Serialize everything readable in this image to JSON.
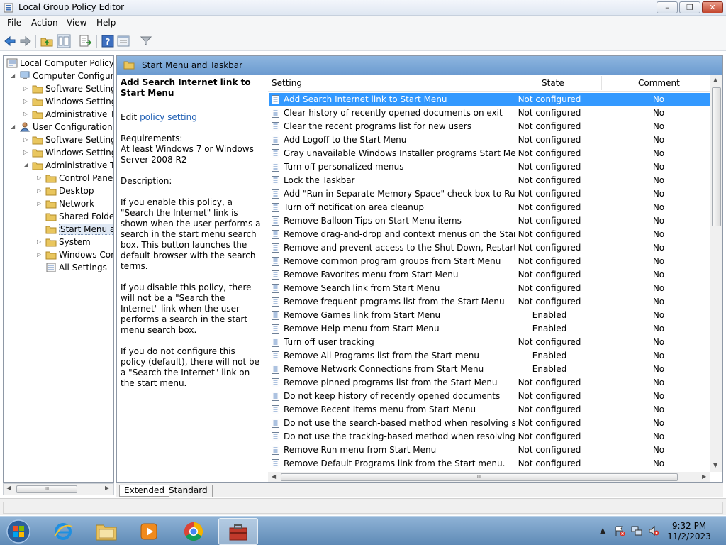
{
  "window": {
    "title": "Local Group Policy Editor",
    "controls": {
      "minimize": "–",
      "maximize": "❐",
      "close": "✕"
    }
  },
  "menu": [
    "File",
    "Action",
    "View",
    "Help"
  ],
  "toolbar": {
    "icons": [
      "back-icon",
      "forward-icon",
      "up-folder-icon",
      "show-hide-tree-icon",
      "export-list-icon",
      "help-icon",
      "properties-icon",
      "filter-icon"
    ]
  },
  "tree": {
    "nodes": [
      {
        "label": "Local Computer Policy"
      },
      {
        "label": "Computer Configura"
      },
      {
        "label": "Software Settings"
      },
      {
        "label": "Windows Setting:"
      },
      {
        "label": "Administrative Te"
      },
      {
        "label": "User Configuration"
      },
      {
        "label": "Software Settings"
      },
      {
        "label": "Windows Setting:"
      },
      {
        "label": "Administrative Te"
      },
      {
        "label": "Control Panel"
      },
      {
        "label": "Desktop"
      },
      {
        "label": "Network"
      },
      {
        "label": "Shared Folder"
      },
      {
        "label": "Start Menu ar"
      },
      {
        "label": "System"
      },
      {
        "label": "Windows Cor"
      },
      {
        "label": "All Settings"
      }
    ],
    "hscroll_label": "III"
  },
  "pane": {
    "header": "Start Menu and Taskbar"
  },
  "description": {
    "title": "Add Search Internet link to Start Menu",
    "edit_prefix": "Edit ",
    "edit_link": "policy setting",
    "requirements_label": "Requirements:",
    "requirements": "At least Windows 7 or Windows Server 2008 R2",
    "description_label": "Description:",
    "para1": "If you enable this policy, a \"Search the Internet\" link is shown when the user performs a search in the start menu search box.  This button launches the default browser with the search terms.",
    "para2": "If you disable this policy, there will not be a \"Search the Internet\" link when the user performs a search in the start menu search box.",
    "para3": "If you do not configure this policy (default), there will not be a \"Search the Internet\" link on the start menu."
  },
  "list": {
    "columns": {
      "setting": "Setting",
      "state": "State",
      "comment": "Comment"
    },
    "rows": [
      {
        "setting": "Add Search Internet link to Start Menu",
        "state": "Not configured",
        "comment": "No"
      },
      {
        "setting": "Clear history of recently opened documents on exit",
        "state": "Not configured",
        "comment": "No"
      },
      {
        "setting": "Clear the recent programs list for new users",
        "state": "Not configured",
        "comment": "No"
      },
      {
        "setting": "Add Logoff to the Start Menu",
        "state": "Not configured",
        "comment": "No"
      },
      {
        "setting": "Gray unavailable Windows Installer programs Start Menu sh...",
        "state": "Not configured",
        "comment": "No"
      },
      {
        "setting": "Turn off personalized menus",
        "state": "Not configured",
        "comment": "No"
      },
      {
        "setting": "Lock the Taskbar",
        "state": "Not configured",
        "comment": "No"
      },
      {
        "setting": "Add \"Run in Separate Memory Space\" check box to Run dial...",
        "state": "Not configured",
        "comment": "No"
      },
      {
        "setting": "Turn off notification area cleanup",
        "state": "Not configured",
        "comment": "No"
      },
      {
        "setting": "Remove Balloon Tips on Start Menu items",
        "state": "Not configured",
        "comment": "No"
      },
      {
        "setting": "Remove drag-and-drop and context menus on the Start Me...",
        "state": "Not configured",
        "comment": "No"
      },
      {
        "setting": "Remove and prevent access to the Shut Down, Restart, Sleep...",
        "state": "Not configured",
        "comment": "No"
      },
      {
        "setting": "Remove common program groups from Start Menu",
        "state": "Not configured",
        "comment": "No"
      },
      {
        "setting": "Remove Favorites menu from Start Menu",
        "state": "Not configured",
        "comment": "No"
      },
      {
        "setting": "Remove Search link from Start Menu",
        "state": "Not configured",
        "comment": "No"
      },
      {
        "setting": "Remove frequent programs list from the Start Menu",
        "state": "Not configured",
        "comment": "No"
      },
      {
        "setting": "Remove Games link from Start Menu",
        "state": "Enabled",
        "comment": "No"
      },
      {
        "setting": "Remove Help menu from Start Menu",
        "state": "Enabled",
        "comment": "No"
      },
      {
        "setting": "Turn off user tracking",
        "state": "Not configured",
        "comment": "No"
      },
      {
        "setting": "Remove All Programs list from the Start menu",
        "state": "Enabled",
        "comment": "No"
      },
      {
        "setting": "Remove Network Connections from Start Menu",
        "state": "Enabled",
        "comment": "No"
      },
      {
        "setting": "Remove pinned programs list from the Start Menu",
        "state": "Not configured",
        "comment": "No"
      },
      {
        "setting": "Do not keep history of recently opened documents",
        "state": "Not configured",
        "comment": "No"
      },
      {
        "setting": "Remove Recent Items menu from Start Menu",
        "state": "Not configured",
        "comment": "No"
      },
      {
        "setting": "Do not use the search-based method when resolving shell s...",
        "state": "Not configured",
        "comment": "No"
      },
      {
        "setting": "Do not use the tracking-based method when resolving shell ...",
        "state": "Not configured",
        "comment": "No"
      },
      {
        "setting": "Remove Run menu from Start Menu",
        "state": "Not configured",
        "comment": "No"
      },
      {
        "setting": "Remove Default Programs link from the Start menu.",
        "state": "Not configured",
        "comment": "No"
      }
    ],
    "hscroll_label": "III"
  },
  "tabs": [
    {
      "label": "Extended"
    },
    {
      "label": "Standard"
    }
  ],
  "taskbar": {
    "buttons": [
      "start-orb-icon",
      "internet-explorer-icon",
      "file-explorer-icon",
      "media-player-icon",
      "chrome-icon",
      "group-policy-editor-icon"
    ],
    "clock_time": "9:32 PM",
    "clock_date": "11/2/2023"
  },
  "colors": {
    "selection": "#3399ff",
    "pane_header": "#7ea8d8",
    "link": "#1f5fb4",
    "taskbar": "#6f97c0"
  }
}
